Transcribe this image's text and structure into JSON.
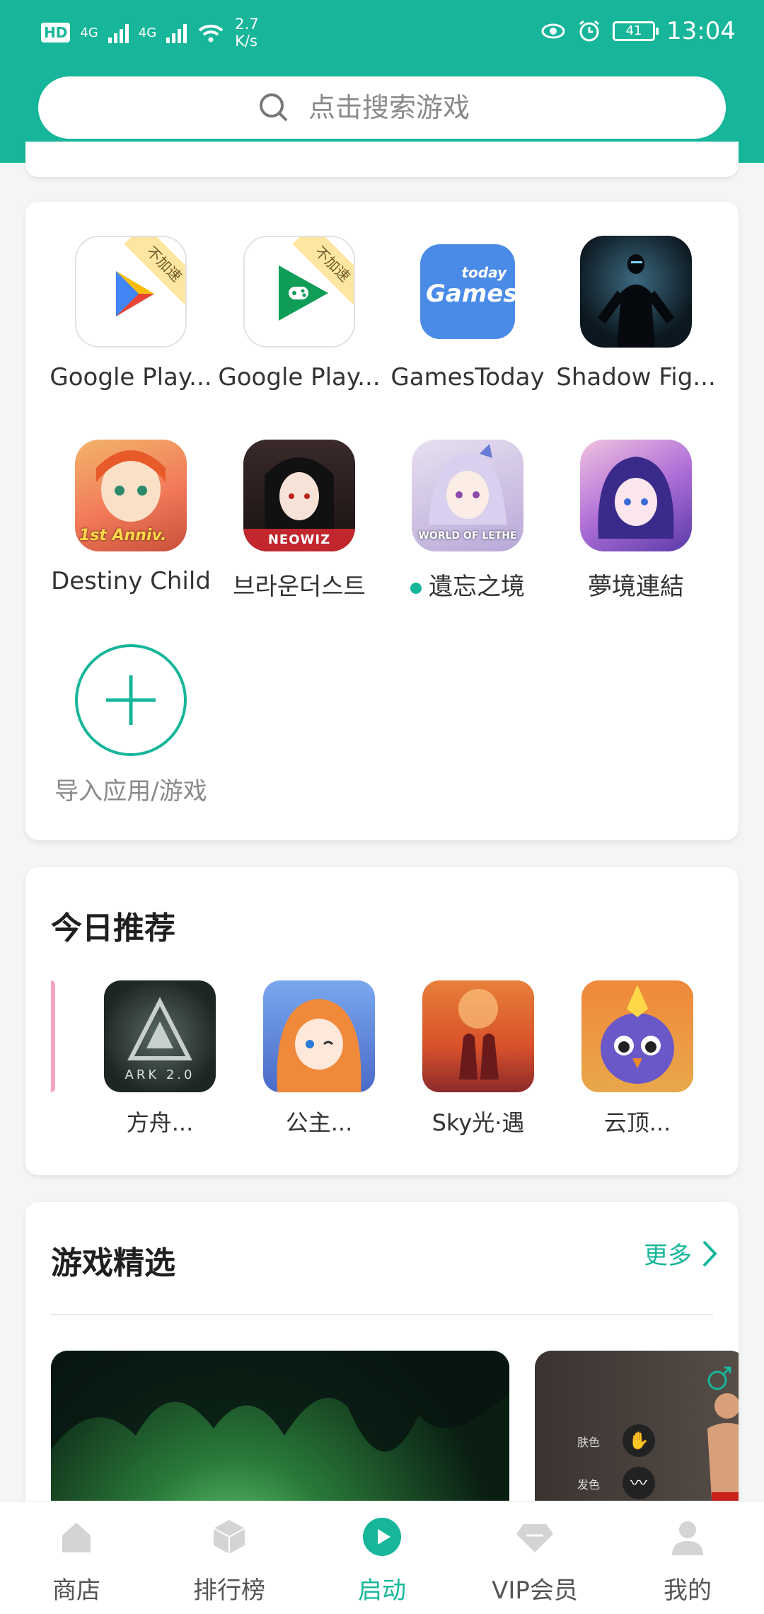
{
  "status_bar": {
    "network_left": "4G",
    "network_right": "4G",
    "speed_value": "2.7",
    "speed_unit": "K/s",
    "battery": "41",
    "time": "13:04"
  },
  "search": {
    "placeholder": "点击搜索游戏"
  },
  "installed": {
    "badge_text": "不加速",
    "apps": [
      {
        "label": "Google Play..."
      },
      {
        "label": "Google Play..."
      },
      {
        "label": "GamesToday"
      },
      {
        "label": "Shadow Fig..."
      },
      {
        "label": "Destiny Child"
      },
      {
        "label": "브라운더스트"
      },
      {
        "label": "遺忘之境"
      },
      {
        "label": "夢境連結"
      }
    ],
    "add_label": "导入应用/游戏",
    "gamestoday_icon_text": "Games",
    "gamestoday_icon_small": "today",
    "destiny_badge": "1st Anniv.",
    "neowiz_badge": "NEOWIZ",
    "lethe_badge": "WORLD OF LETHE"
  },
  "today": {
    "title": "今日推荐",
    "items": [
      {
        "label": "方舟..."
      },
      {
        "label": "公主..."
      },
      {
        "label": "Sky光·遇"
      },
      {
        "label": "云顶..."
      }
    ],
    "ark_text": "ARK 2.0"
  },
  "featured": {
    "title": "游戏精选",
    "more": "更多",
    "preview_labels": [
      "肤色",
      "发色"
    ]
  },
  "nav": {
    "items": [
      {
        "label": "商店"
      },
      {
        "label": "排行榜"
      },
      {
        "label": "启动"
      },
      {
        "label": "VIP会员"
      },
      {
        "label": "我的"
      }
    ]
  },
  "colors": {
    "accent": "#17b69a"
  }
}
